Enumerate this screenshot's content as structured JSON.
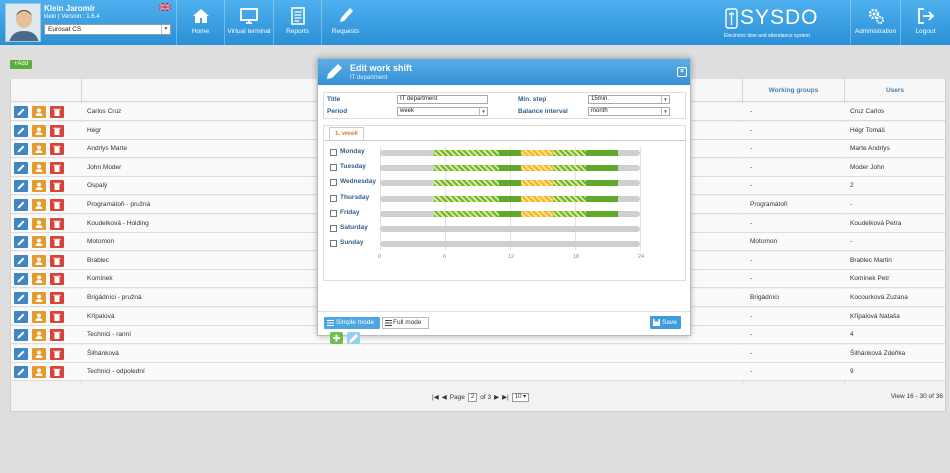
{
  "header": {
    "user_name": "Klein Jaromír",
    "user_version": "klein | Version : 1.6.4",
    "company": "Eurosat CS",
    "nav_left": [
      {
        "label": "Home",
        "icon": "home-icon"
      },
      {
        "label": "Virtual terminal",
        "icon": "monitor-icon"
      },
      {
        "label": "Reports",
        "icon": "reports-icon"
      },
      {
        "label": "Requests",
        "icon": "pen-icon"
      }
    ],
    "logo_text": "SYSDO",
    "logo_sub": "Electronic time and attendance system",
    "nav_right": [
      {
        "label": "Administration",
        "icon": "gears-icon"
      },
      {
        "label": "Logout",
        "icon": "logout-icon"
      }
    ]
  },
  "toolbar": {
    "add_label": "+Add"
  },
  "table": {
    "headers": {
      "working_groups": "Working groups",
      "users": "Users"
    },
    "rows": [
      {
        "name": "Carlos Cruz",
        "wg": "-",
        "users": "Cruz Carlos"
      },
      {
        "name": "Hégr",
        "wg": "-",
        "users": "Hégr Tomáš"
      },
      {
        "name": "Andrlys Marte",
        "wg": "-",
        "users": "Marte Andrlys"
      },
      {
        "name": "John Moder",
        "wg": "-",
        "users": "Moder John"
      },
      {
        "name": "Ospalý",
        "wg": "-",
        "users": "2"
      },
      {
        "name": "Programátoři - pružná",
        "wg": "Programátoři",
        "users": "-"
      },
      {
        "name": "Koudelková - Holding",
        "wg": "-",
        "users": "Koudelková Petra"
      },
      {
        "name": "Motomon",
        "wg": "Motomon",
        "users": "-"
      },
      {
        "name": "Brablec",
        "wg": "-",
        "users": "Brablec Martin"
      },
      {
        "name": "Komínek",
        "wg": "-",
        "users": "Komínek Petr"
      },
      {
        "name": "Brigádníci - pružná",
        "wg": "Brigádníci",
        "users": "Kocourková Zuzana"
      },
      {
        "name": "Křípalová",
        "wg": "-",
        "users": "Křípalová Nataša"
      },
      {
        "name": "Technici - ranní",
        "wg": "-",
        "users": "4"
      },
      {
        "name": "Šilhánková",
        "wg": "-",
        "users": "Šilhánková Zdeňka"
      },
      {
        "name": "Technici - odpolední",
        "wg": "-",
        "users": "9"
      }
    ]
  },
  "pager": {
    "page_label": "Page",
    "page": "2",
    "of_label": "of 3",
    "per_page": "10",
    "view": "View 16 - 30 of 36"
  },
  "modal": {
    "title": "Edit work shift",
    "subtitle": "IT department",
    "close": "×",
    "form": {
      "title_label": "Title",
      "title_value": "IT department",
      "period_label": "Period",
      "period_value": "week",
      "min_step_label": "Min. step",
      "min_step_value": "15min.",
      "balance_label": "Balance interval",
      "balance_value": "month"
    },
    "tab": "1. week",
    "days": [
      {
        "label": "Monday",
        "shift": [
          [
            5,
            11,
            "hatch"
          ],
          [
            11,
            13,
            "solid"
          ],
          [
            13,
            16,
            "orange"
          ],
          [
            16,
            19,
            "hatch"
          ],
          [
            19,
            22,
            "solid"
          ]
        ],
        "checked": false
      },
      {
        "label": "Tuesday",
        "shift": [
          [
            5,
            11,
            "hatch"
          ],
          [
            11,
            13,
            "solid"
          ],
          [
            13,
            16,
            "orange"
          ],
          [
            16,
            19,
            "hatch"
          ],
          [
            19,
            22,
            "solid"
          ]
        ],
        "checked": false
      },
      {
        "label": "Wednesday",
        "shift": [
          [
            5,
            11,
            "hatch"
          ],
          [
            11,
            13,
            "solid"
          ],
          [
            13,
            16,
            "orange"
          ],
          [
            16,
            19,
            "hatch"
          ],
          [
            19,
            22,
            "solid"
          ]
        ],
        "checked": false
      },
      {
        "label": "Thursday",
        "shift": [
          [
            5,
            11,
            "hatch"
          ],
          [
            11,
            13,
            "solid"
          ],
          [
            13,
            16,
            "orange"
          ],
          [
            16,
            19,
            "hatch"
          ],
          [
            19,
            22,
            "solid"
          ]
        ],
        "checked": false
      },
      {
        "label": "Friday",
        "shift": [
          [
            5,
            11,
            "hatch"
          ],
          [
            11,
            13,
            "solid"
          ],
          [
            13,
            16,
            "orange"
          ],
          [
            16,
            19,
            "hatch"
          ],
          [
            19,
            22,
            "solid"
          ]
        ],
        "checked": false
      },
      {
        "label": "Saturday",
        "shift": [],
        "checked": false
      },
      {
        "label": "Sunday",
        "shift": [],
        "checked": false
      }
    ],
    "axis_ticks": [
      "0",
      "6",
      "12",
      "18",
      "24"
    ],
    "buttons": {
      "simple_mode": "Simple mode",
      "full_mode": "Full mode",
      "save": "Save"
    }
  },
  "colors": {
    "accent": "#3590d4",
    "edit": "#3f86c3",
    "user": "#e59a2f",
    "delete": "#d6453a",
    "work": "#62a82a",
    "break": "#f2b42a"
  }
}
